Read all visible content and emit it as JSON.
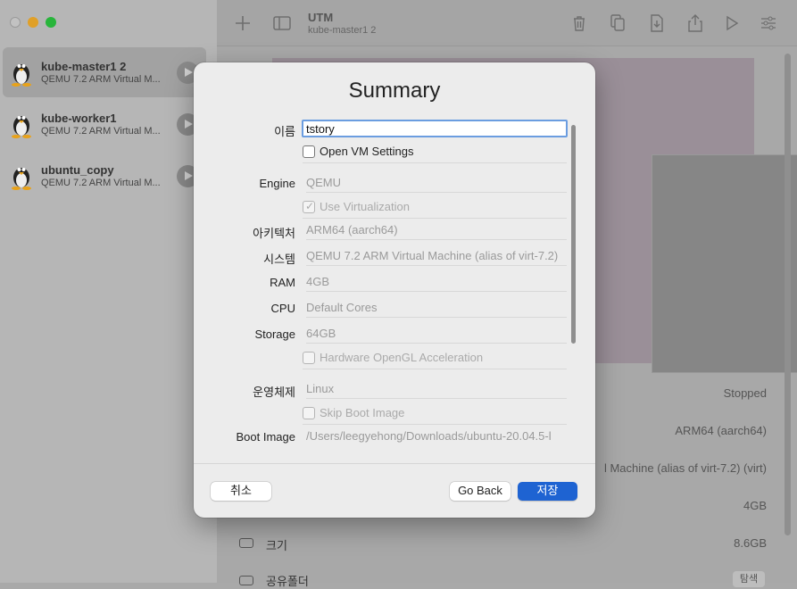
{
  "window": {
    "title": "UTM",
    "subtitle": "kube-master1 2"
  },
  "sidebar": {
    "vms": [
      {
        "name": "kube-master1 2",
        "desc": "QEMU 7.2 ARM Virtual M...",
        "selected": true
      },
      {
        "name": "kube-worker1",
        "desc": "QEMU 7.2 ARM Virtual M...",
        "selected": false
      },
      {
        "name": "ubuntu_copy",
        "desc": "QEMU 7.2 ARM Virtual M...",
        "selected": false
      }
    ]
  },
  "toolbar": {
    "icons": [
      "plus-icon",
      "sidebar-toggle-icon",
      "trash-icon",
      "clone-icon",
      "download-icon",
      "share-icon",
      "play-icon",
      "settings-sliders-icon"
    ]
  },
  "details": {
    "status": "Stopped",
    "architecture": "ARM64 (aarch64)",
    "machine": "l Machine (alias of virt-7.2) (virt)",
    "ram": "4GB",
    "size_label": "크기",
    "size": "8.6GB",
    "shared_label": "공유폴더",
    "shared_action": "탐색"
  },
  "dialog": {
    "title": "Summary",
    "name_label": "이름",
    "name_value": "tstory",
    "open_settings": "Open VM Settings",
    "engine_label": "Engine",
    "engine_value": "QEMU",
    "use_virtualization": "Use Virtualization",
    "arch_label": "아키텍처",
    "arch_value": "ARM64 (aarch64)",
    "system_label": "시스템",
    "system_value": "QEMU 7.2 ARM Virtual Machine (alias of virt-7.2)",
    "ram_label": "RAM",
    "ram_value": "4GB",
    "cpu_label": "CPU",
    "cpu_value": "Default Cores",
    "storage_label": "Storage",
    "storage_value": "64GB",
    "opengl": "Hardware OpenGL Acceleration",
    "os_label": "운영체제",
    "os_value": "Linux",
    "skip_boot": "Skip Boot Image",
    "boot_label": "Boot Image",
    "boot_value": "/Users/leegyehong/Downloads/ubuntu-20.04.5-l",
    "cancel": "취소",
    "go_back": "Go Back",
    "save": "저장"
  }
}
